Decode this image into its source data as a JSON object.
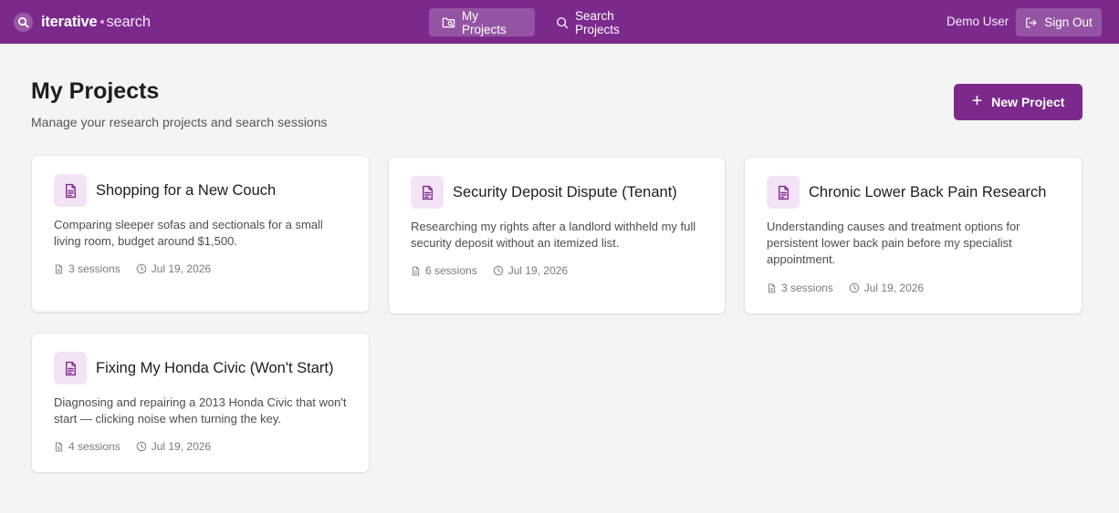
{
  "brand": {
    "name_bold": "iterative",
    "name_light": "search"
  },
  "nav": {
    "my_projects": "My Projects",
    "search_projects": "Search Projects"
  },
  "user": {
    "name": "Demo User",
    "sign_out": "Sign Out"
  },
  "header": {
    "title": "My Projects",
    "subtitle": "Manage your research projects and search sessions",
    "new_project": "New Project"
  },
  "projects": [
    {
      "title": "Shopping for a New Couch",
      "description": "Comparing sleeper sofas and sectionals for a small living room, budget around $1,500.",
      "sessions": "3 sessions",
      "date": "Jul 19, 2026"
    },
    {
      "title": "Security Deposit Dispute (Tenant)",
      "description": "Researching my rights after a landlord withheld my full security deposit without an itemized list.",
      "sessions": "6 sessions",
      "date": "Jul 19, 2026"
    },
    {
      "title": "Chronic Lower Back Pain Research",
      "description": "Understanding causes and treatment options for persistent lower back pain before my specialist appointment.",
      "sessions": "3 sessions",
      "date": "Jul 19, 2026"
    },
    {
      "title": "Fixing My Honda Civic (Won't Start)",
      "description": "Diagnosing and repairing a 2013 Honda Civic that won't start — clicking noise when turning the key.",
      "sessions": "4 sessions",
      "date": "Jul 19, 2026"
    }
  ],
  "colors": {
    "brand_purple": "#7b2a8c",
    "icon_bg": "#f4e3f6",
    "page_bg": "#f5f4f5"
  },
  "icons": {
    "brand": "search-icon",
    "my_projects": "folder-search-icon",
    "search_projects": "search-icon",
    "sign_out": "sign-out-icon",
    "new_project": "plus-icon",
    "card": "document-icon",
    "sessions": "file-icon",
    "date": "clock-icon"
  }
}
